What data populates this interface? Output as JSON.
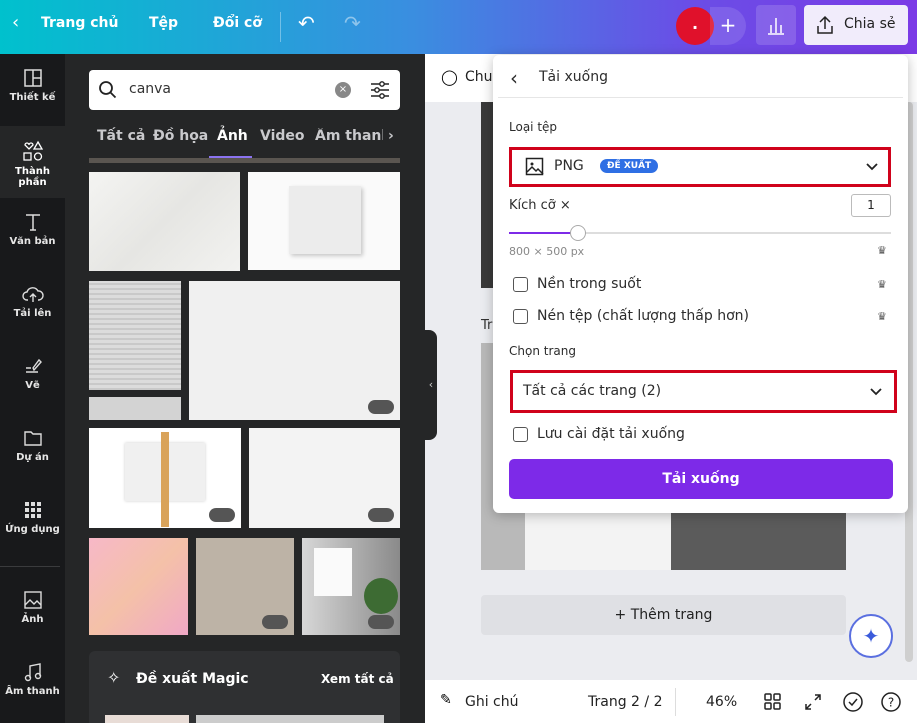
{
  "topbar": {
    "home": "Trang chủ",
    "file": "Tệp",
    "resize": "Đổi cỡ",
    "avatar": ".",
    "share": "Chia sẻ"
  },
  "rail": [
    {
      "label": "Thiết kế"
    },
    {
      "label": "Thành phần"
    },
    {
      "label": "Văn bản"
    },
    {
      "label": "Tải lên"
    },
    {
      "label": "Vẽ"
    },
    {
      "label": "Dự án"
    },
    {
      "label": "Ứng dụng"
    },
    {
      "label": "Ảnh"
    },
    {
      "label": "Âm thanh"
    }
  ],
  "panel": {
    "search_value": "canva",
    "tabs": [
      "Tất cả",
      "Đồ họa",
      "Ảnh",
      "Video",
      "Âm thanh"
    ],
    "active_tab": "Ảnh",
    "magic_title": "Đề xuất Magic",
    "see_all": "Xem tất cả"
  },
  "canvas": {
    "toolbar_partial": "Chuy",
    "page_title_partial": "Tr",
    "add_page": "+ Thêm trang"
  },
  "bottombar": {
    "notes": "Ghi chú",
    "page": "Trang 2 / 2",
    "zoom": "46%"
  },
  "download": {
    "title": "Tải xuống",
    "file_type_label": "Loại tệp",
    "file_type": "PNG",
    "recommended": "ĐỀ XUẤT",
    "size_label": "Kích cỡ ×",
    "size_value": "1",
    "size_slider_fraction": 0.18,
    "dimensions": "800 × 500 px",
    "transparent": "Nền trong suốt",
    "compress": "Nén tệp (chất lượng thấp hơn)",
    "pages_label": "Chọn trang",
    "pages_value": "Tất cả các trang (2)",
    "save_settings": "Lưu cài đặt tải xuống",
    "download_button": "Tải xuống"
  },
  "colors": {
    "accent": "#7d2ae8",
    "highlight": "#d0021b",
    "badge": "#2f6fe4"
  }
}
